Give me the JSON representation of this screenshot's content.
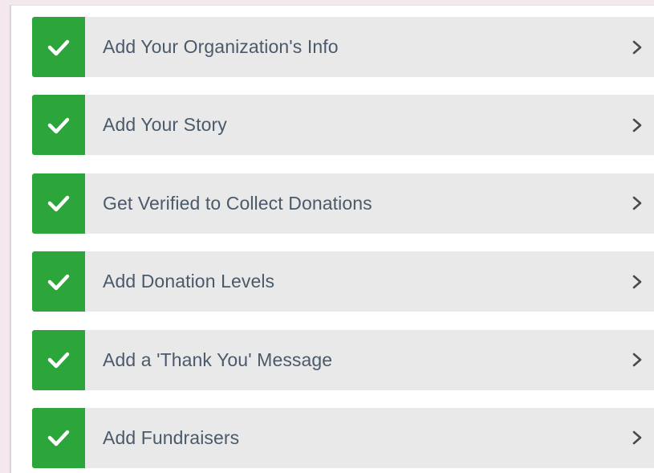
{
  "steps": [
    {
      "label": "Add Your Organization's Info",
      "status_icon": "check-icon",
      "arrow_icon": "chevron-right-icon"
    },
    {
      "label": "Add Your Story",
      "status_icon": "check-icon",
      "arrow_icon": "chevron-right-icon"
    },
    {
      "label": "Get Verified to Collect Donations",
      "status_icon": "check-icon",
      "arrow_icon": "chevron-right-icon"
    },
    {
      "label": "Add Donation Levels",
      "status_icon": "check-icon",
      "arrow_icon": "chevron-right-icon"
    },
    {
      "label": "Add a 'Thank You' Message",
      "status_icon": "check-icon",
      "arrow_icon": "chevron-right-icon"
    },
    {
      "label": "Add Fundraisers",
      "status_icon": "check-icon",
      "arrow_icon": "chevron-right-icon"
    }
  ],
  "colors": {
    "complete_green": "#2ca53a",
    "row_background": "#e9e9e9",
    "label_text": "#4b5a6b",
    "chevron": "#4a4a4a",
    "page_background": "#f4e8ee"
  }
}
